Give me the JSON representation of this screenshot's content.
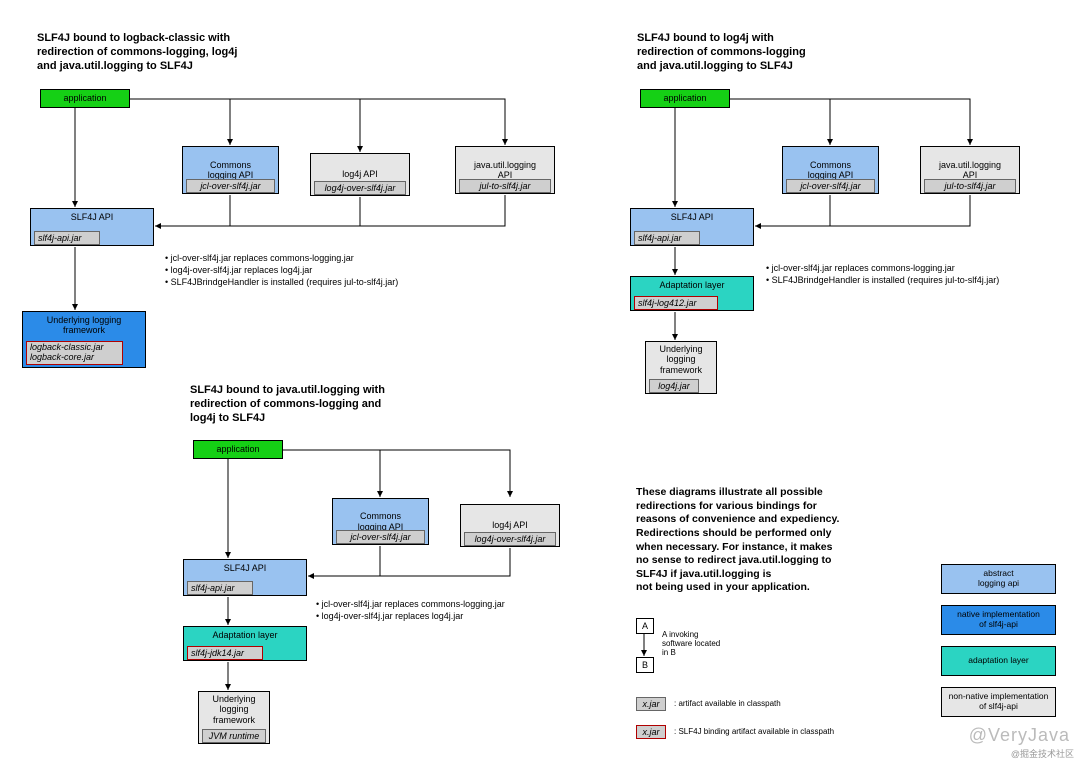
{
  "d1": {
    "title": "SLF4J bound to logback-classic with\nredirection of commons-logging, log4j\nand java.util.logging to SLF4J",
    "app": "application",
    "commons": "Commons\nlogging API",
    "commons_jar": "jcl-over-slf4j.jar",
    "log4j": "log4j API",
    "log4j_jar": "log4j-over-slf4j.jar",
    "jul": "java.util.logging\nAPI",
    "jul_jar": "jul-to-slf4j.jar",
    "slf4j": "SLF4J API",
    "slf4j_jar": "slf4j-api.jar",
    "framework": "Underlying logging\nframework",
    "framework_jar": "logback-classic.jar\nlogback-core.jar",
    "b1": "• jcl-over-slf4j.jar replaces commons-logging.jar",
    "b2": "• log4j-over-slf4j.jar replaces log4j.jar",
    "b3": "• SLF4JBrindgeHandler is installed (requires jul-to-slf4j.jar)"
  },
  "d2": {
    "title": "SLF4J bound to java.util.logging with\nredirection of commons-logging and\nlog4j to SLF4J",
    "app": "application",
    "commons": "Commons\nlogging API",
    "commons_jar": "jcl-over-slf4j.jar",
    "log4j": "log4j API",
    "log4j_jar": "log4j-over-slf4j.jar",
    "slf4j": "SLF4J API",
    "slf4j_jar": "slf4j-api.jar",
    "adapt": "Adaptation layer",
    "adapt_jar": "slf4j-jdk14.jar",
    "framework": "Underlying\nlogging\nframework",
    "framework_jar": "JVM runtime",
    "b1": "• jcl-over-slf4j.jar replaces commons-logging.jar",
    "b2": "• log4j-over-slf4j.jar replaces log4j.jar"
  },
  "d3": {
    "title": "SLF4J bound to log4j with\nredirection of commons-logging\nand java.util.logging to SLF4J",
    "app": "application",
    "commons": "Commons\nlogging API",
    "commons_jar": "jcl-over-slf4j.jar",
    "jul": "java.util.logging\nAPI",
    "jul_jar": "jul-to-slf4j.jar",
    "slf4j": "SLF4J API",
    "slf4j_jar": "slf4j-api.jar",
    "adapt": "Adaptation layer",
    "adapt_jar": "slf4j-log412.jar",
    "framework": "Underlying\nlogging\nframework",
    "framework_jar": "log4j.jar",
    "b1": "• jcl-over-slf4j.jar replaces commons-logging.jar",
    "b2": "• SLF4JBrindgeHandler is installed (requires jul-to-slf4j.jar)"
  },
  "desc": "These diagrams illustrate all possible\nredirections for various bindings for\nreasons of convenience and expediency.\nRedirections should be performed only\nwhen necessary. For instance, it makes\nno sense to redirect java.util.logging to\nSLF4J if java.util.logging is\nnot being used in your application.",
  "legend": {
    "a": "A",
    "b": "B",
    "ab_text": "A invoking\nsoftware located\nin B",
    "xjar": "x.jar",
    "xjar_text": ": artifact available in classpath",
    "xjar2": "x.jar",
    "xjar2_text": ": SLF4J binding artifact available in classpath",
    "abstract": "abstract\nlogging api",
    "native": "native implementation\nof slf4j-api",
    "adapt": "adaptation layer",
    "nonnative": "non-native implementation\nof slf4j-api"
  },
  "watermark": "@VeryJava",
  "watermark2": "@掘金技术社区"
}
